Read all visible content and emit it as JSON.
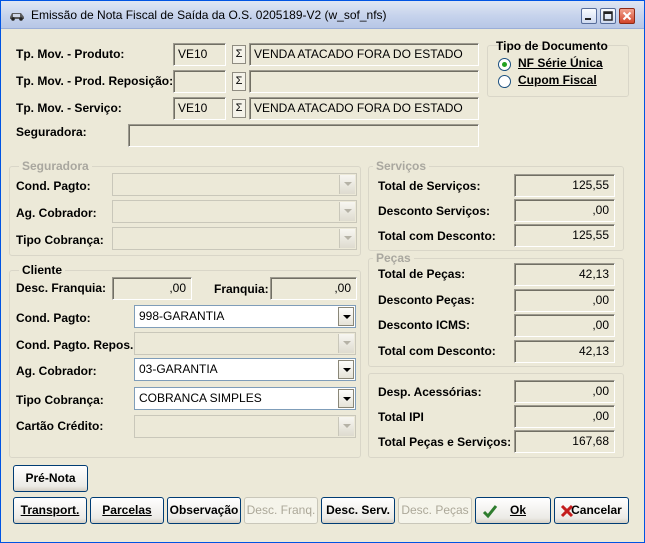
{
  "window": {
    "title": "Emissão de Nota Fiscal de Saída da O.S. 0205189-V2 (w_sof_nfs)"
  },
  "top": {
    "tp_mov_produto": {
      "label": "Tp. Mov. - Produto:",
      "code": "VE10",
      "desc": "VENDA ATACADO FORA DO ESTADO"
    },
    "tp_mov_reposicao": {
      "label": "Tp. Mov. - Prod. Reposição:",
      "code": "",
      "desc": ""
    },
    "tp_mov_servico": {
      "label": "Tp. Mov. - Serviço:",
      "code": "VE10",
      "desc": "VENDA ATACADO FORA DO ESTADO"
    },
    "seguradora": {
      "label": "Seguradora:",
      "value": ""
    },
    "sigma_symbol": "Σ"
  },
  "tipo_documento": {
    "title": "Tipo de Documento",
    "options": [
      {
        "label": "NF Série Única",
        "selected": true
      },
      {
        "label": "Cupom Fiscal",
        "selected": false
      }
    ]
  },
  "seguradora_group": {
    "title": "Seguradora",
    "cond_pagto": "Cond. Pagto:",
    "ag_cobrador": "Ag. Cobrador:",
    "tipo_cobranca": "Tipo Cobrança:"
  },
  "cliente_group": {
    "title": "Cliente",
    "desc_franquia": {
      "label": "Desc. Franquia:",
      "value": ",00"
    },
    "franquia": {
      "label": "Franquia:",
      "value": ",00"
    },
    "cond_pagto": {
      "label": "Cond. Pagto:",
      "value": "998-GARANTIA"
    },
    "cond_pagto_repos": {
      "label": "Cond. Pagto. Repos.:",
      "value": ""
    },
    "ag_cobrador": {
      "label": "Ag. Cobrador:",
      "value": "03-GARANTIA"
    },
    "tipo_cobranca": {
      "label": "Tipo Cobrança:",
      "value": "COBRANCA SIMPLES"
    },
    "cartao_credito": {
      "label": "Cartão Crédito:",
      "value": ""
    }
  },
  "servicos": {
    "title": "Serviços",
    "total": {
      "label": "Total de Serviços:",
      "value": "125,55"
    },
    "desconto": {
      "label": "Desconto Serviços:",
      "value": ",00"
    },
    "total_desc": {
      "label": "Total com Desconto:",
      "value": "125,55"
    }
  },
  "pecas": {
    "title": "Peças",
    "total": {
      "label": "Total de Peças:",
      "value": "42,13"
    },
    "desconto": {
      "label": "Desconto Peças:",
      "value": ",00"
    },
    "desconto_icms": {
      "label": "Desconto ICMS:",
      "value": ",00"
    },
    "total_desc": {
      "label": "Total com Desconto:",
      "value": "42,13"
    }
  },
  "totais": {
    "desp_acessorias": {
      "label": "Desp. Acessórias:",
      "value": ",00"
    },
    "total_ipi": {
      "label": "Total IPI",
      "value": ",00"
    },
    "total_geral": {
      "label": "Total Peças e Serviços:",
      "value": "167,68"
    }
  },
  "buttons": {
    "pre_nota": "Pré-Nota",
    "transport": "Transport.",
    "parcelas": "Parcelas",
    "observacao": "Observação",
    "desc_franq": "Desc. Franq.",
    "desc_serv": "Desc. Serv.",
    "desc_pecas": "Desc. Peças",
    "ok": "Ok",
    "cancelar": "Cancelar"
  },
  "colors": {
    "ok_check": "#2f7d2f",
    "cancel_x": "#c41e1e",
    "radio_dot": "#21a121"
  },
  "icons": [
    "car-icon",
    "minimize-icon",
    "maximize-icon",
    "close-icon",
    "sigma-icon",
    "checkmark-icon",
    "x-icon"
  ]
}
